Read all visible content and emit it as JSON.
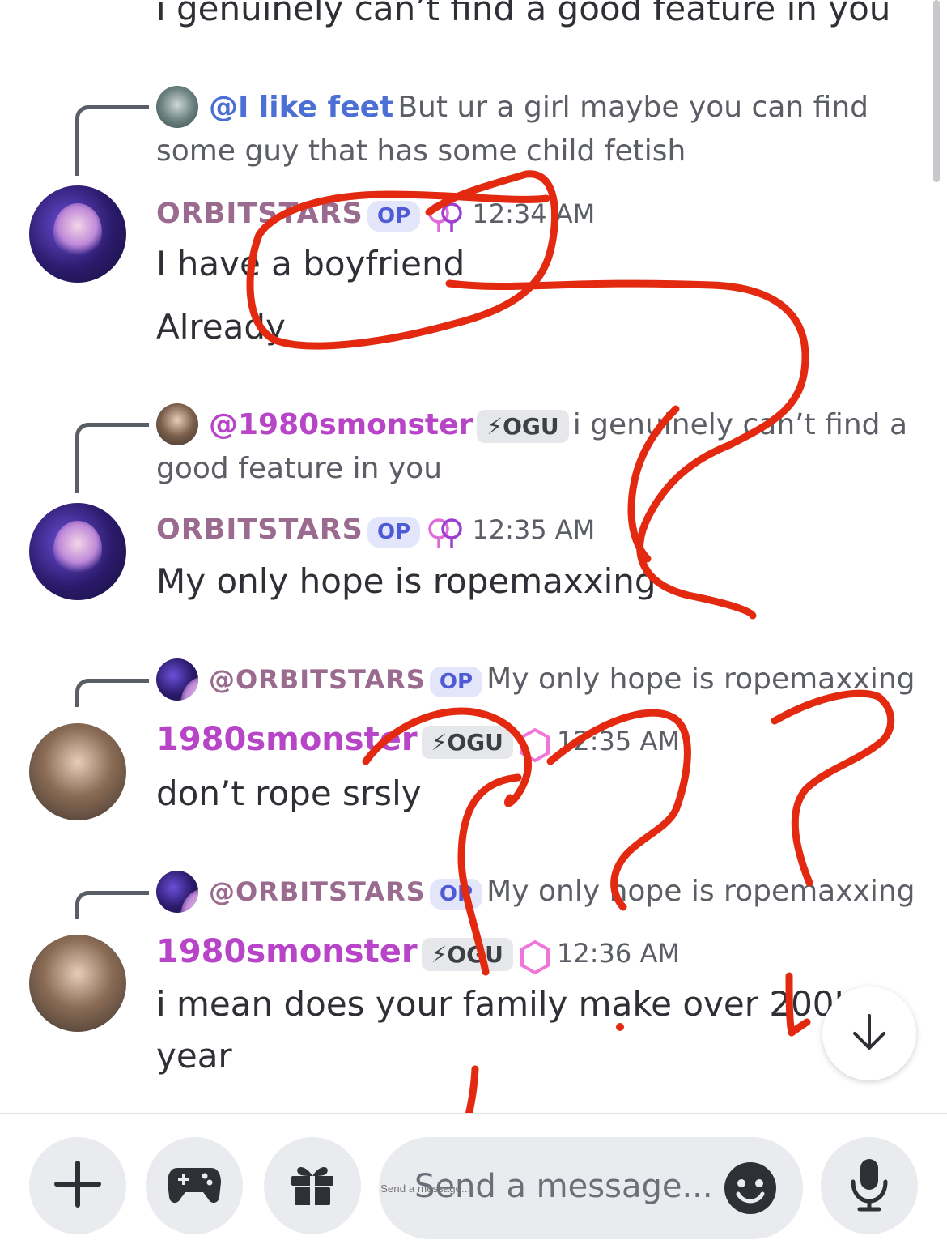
{
  "top_cut_text": "i genuinely can’t find a good feature in you",
  "messages": [
    {
      "reply": {
        "mention": "@I like feet",
        "text_line1": "But ur a girl maybe you can find",
        "text_line2": "some guy that has some child fetish"
      },
      "author": "ORBITSTARS",
      "op_badge": "OP",
      "time": "12:34 AM",
      "lines": [
        "I have a boyfriend",
        "Already"
      ]
    },
    {
      "reply": {
        "mention": "@1980smonster",
        "badge": "OGU",
        "text_line1": "i genuinely can’t find a",
        "text_line2": "good feature in you"
      },
      "author": "ORBITSTARS",
      "op_badge": "OP",
      "time": "12:35 AM",
      "lines": [
        "My only hope is ropemaxxing"
      ]
    },
    {
      "reply": {
        "mention": "@ORBITSTARS",
        "badge": "OP",
        "text_line1": "My only hope is ropemaxxing"
      },
      "author": "1980smonster",
      "badge": "OGU",
      "time": "12:35 AM",
      "lines": [
        "don’t rope srsly"
      ]
    },
    {
      "reply": {
        "mention": "@ORBITSTARS",
        "badge": "OP",
        "text_line1": "My only hope is ropemaxxing"
      },
      "author": "1980smonster",
      "badge": "OGU",
      "time": "12:36 AM",
      "lines": [
        "i mean does your family make over 200K a",
        "year"
      ]
    }
  ],
  "composer": {
    "placeholder": "Send a message..."
  },
  "icons": {
    "add": "plus-icon",
    "games": "gamepad-icon",
    "gift": "gift-icon",
    "emoji": "emoji-icon",
    "mic": "microphone-icon",
    "scroll": "arrow-down-icon",
    "gender": "female-symbols-icon",
    "nitro": "nitro-gem-icon"
  },
  "colors": {
    "annotation_red": "#e32a10",
    "op_badge_bg": "#e3e5fb",
    "op_badge_text": "#4f5bd5",
    "orbitstars_name": "#9a6b8e",
    "monster_name": "#b845c8"
  }
}
